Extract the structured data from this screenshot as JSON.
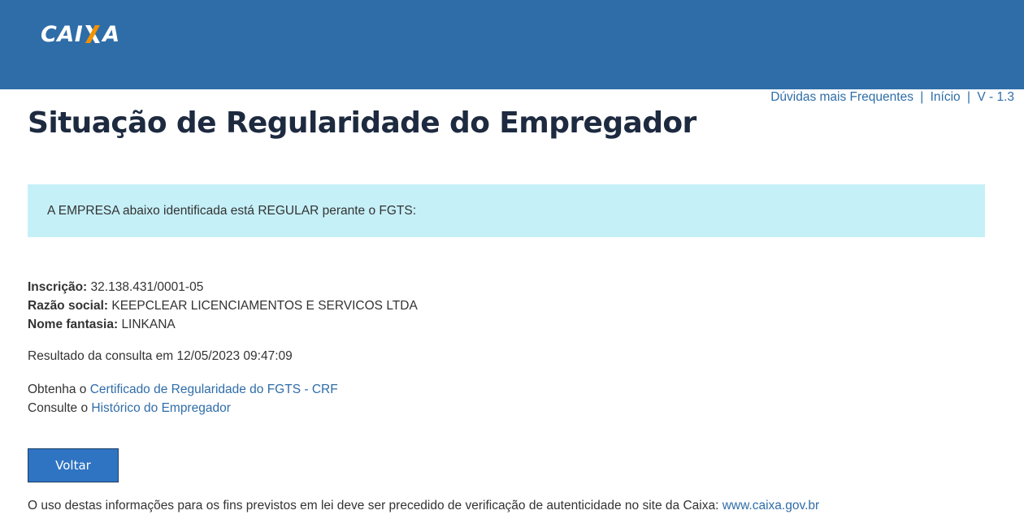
{
  "header": {
    "logo_left": "CAI",
    "logo_right": "A",
    "brand_color": "#2f6da8",
    "logo_accent_color": "#f39200"
  },
  "toplinks": {
    "faq": "Dúvidas mais Frequentes",
    "separator": "|",
    "home": "Início",
    "version": "V - 1.3"
  },
  "page": {
    "title": "Situação de Regularidade do Empregador"
  },
  "alert": {
    "message": "A EMPRESA abaixo identificada está REGULAR perante o FGTS:",
    "background": "#c6f0f8"
  },
  "company": {
    "inscricao_label": "Inscrição:",
    "inscricao_value": "32.138.431/0001-05",
    "razao_label": "Razão social:",
    "razao_value": "KEEPCLEAR LICENCIAMENTOS E SERVICOS LTDA",
    "fantasia_label": "Nome fantasia:",
    "fantasia_value": "LINKANA"
  },
  "result": {
    "text": "Resultado da consulta em 12/05/2023 09:47:09"
  },
  "links": {
    "crf_prefix": "Obtenha o",
    "crf_link": "Certificado de Regularidade do FGTS - CRF",
    "historico_prefix": "Consulte o",
    "historico_link": "Histórico do Empregador"
  },
  "actions": {
    "back_label": "Voltar"
  },
  "footer": {
    "note": "O uso destas informações para os fins previstos em lei deve ser precedido de verificação de autenticidade no site da Caixa:",
    "site_link": "www.caixa.gov.br"
  }
}
